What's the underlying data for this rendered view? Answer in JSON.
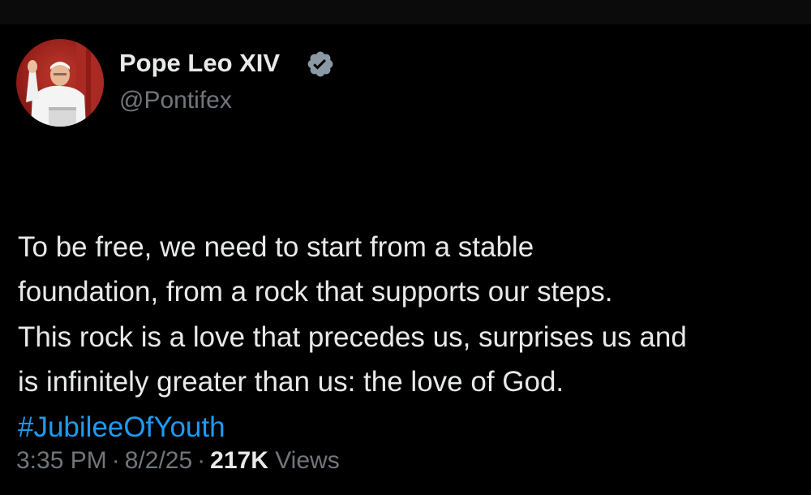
{
  "author": {
    "name": "Pope Leo XIV",
    "handle": "@Pontifex",
    "verified": true,
    "badge_color": "#8b98a5"
  },
  "tweet": {
    "text": "To be free, we need to start from a stable\nfoundation, from a rock that supports our steps.\nThis rock is a love that precedes us, surprises us and\nis infinitely greater than us: the love of God.",
    "hashtag": "#JubileeOfYouth"
  },
  "meta": {
    "time": "3:35 PM",
    "separator": "·",
    "date": "8/2/25",
    "views_count": "217K",
    "views_label": " Views"
  },
  "colors": {
    "background": "#000000",
    "text_primary": "#e7e9ea",
    "text_secondary": "#71767b",
    "link": "#1d9bf0"
  },
  "icons": {
    "verified": "verified-badge-icon",
    "avatar": "avatar-photo"
  }
}
